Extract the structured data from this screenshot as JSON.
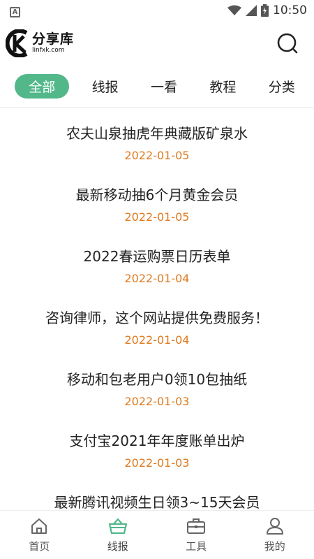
{
  "status_bar": {
    "left_badge": "A",
    "time": "10:50"
  },
  "header": {
    "logo_cn": "分享库",
    "logo_en": "linfxk.com"
  },
  "tabs": [
    {
      "label": "全部",
      "active": true
    },
    {
      "label": "线报",
      "active": false
    },
    {
      "label": "一看",
      "active": false
    },
    {
      "label": "教程",
      "active": false
    },
    {
      "label": "分类",
      "active": false
    }
  ],
  "items": [
    {
      "title": "农夫山泉抽虎年典藏版矿泉水",
      "date": "2022-01-05"
    },
    {
      "title": "最新移动抽6个月黄金会员",
      "date": "2022-01-05"
    },
    {
      "title": "2022春运购票日历表单",
      "date": "2022-01-04"
    },
    {
      "title": "咨询律师，这个网站提供免费服务！",
      "date": "2022-01-04"
    },
    {
      "title": "移动和包老用户0领10包抽纸",
      "date": "2022-01-03"
    },
    {
      "title": "支付宝2021年年度账单出炉",
      "date": "2022-01-03"
    },
    {
      "title": "最新腾讯视频生日领3~15天会员",
      "date": ""
    }
  ],
  "bottom_nav": [
    {
      "label": "首页",
      "icon": "home-icon"
    },
    {
      "label": "线报",
      "icon": "basket-icon"
    },
    {
      "label": "工具",
      "icon": "toolbox-icon"
    },
    {
      "label": "我的",
      "icon": "user-icon"
    }
  ],
  "colors": {
    "accent": "#52b88a",
    "date": "#e07a1f"
  }
}
